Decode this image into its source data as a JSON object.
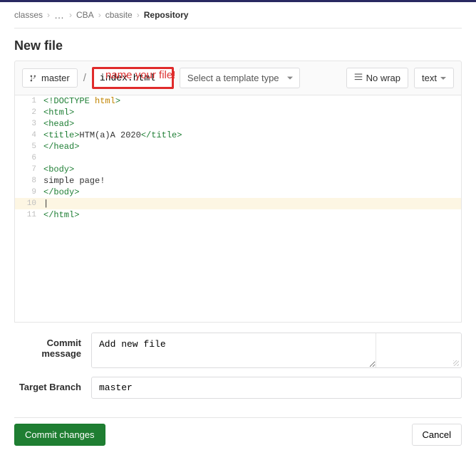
{
  "breadcrumbs": {
    "items": [
      "classes",
      "…",
      "CBA",
      "cbasite"
    ],
    "current": "Repository"
  },
  "page_title": "New file",
  "annotation": "name your file!",
  "toolbar": {
    "branch": "master",
    "filename": "index.html",
    "template_placeholder": "Select a template type",
    "nowrap": "No wrap",
    "mode": "text"
  },
  "code_lines": [
    {
      "n": 1,
      "tokens": [
        {
          "t": "<!DOCTYPE ",
          "c": "tok-doctype"
        },
        {
          "t": "html",
          "c": "tok-attr"
        },
        {
          "t": ">",
          "c": "tok-doctype"
        }
      ]
    },
    {
      "n": 2,
      "tokens": [
        {
          "t": "<",
          "c": "tok-tag"
        },
        {
          "t": "html",
          "c": "tok-tag"
        },
        {
          "t": ">",
          "c": "tok-tag"
        }
      ]
    },
    {
      "n": 3,
      "tokens": [
        {
          "t": "<",
          "c": "tok-tag"
        },
        {
          "t": "head",
          "c": "tok-tag"
        },
        {
          "t": ">",
          "c": "tok-tag"
        }
      ]
    },
    {
      "n": 4,
      "tokens": [
        {
          "t": "<",
          "c": "tok-tag"
        },
        {
          "t": "title",
          "c": "tok-tag"
        },
        {
          "t": ">",
          "c": "tok-tag"
        },
        {
          "t": "HTM(a)A 2020",
          "c": "tok-text"
        },
        {
          "t": "</",
          "c": "tok-tag"
        },
        {
          "t": "title",
          "c": "tok-tag"
        },
        {
          "t": ">",
          "c": "tok-tag"
        }
      ]
    },
    {
      "n": 5,
      "tokens": [
        {
          "t": "</",
          "c": "tok-tag"
        },
        {
          "t": "head",
          "c": "tok-tag"
        },
        {
          "t": ">",
          "c": "tok-tag"
        }
      ]
    },
    {
      "n": 6,
      "tokens": []
    },
    {
      "n": 7,
      "tokens": [
        {
          "t": "<",
          "c": "tok-tag"
        },
        {
          "t": "body",
          "c": "tok-tag"
        },
        {
          "t": ">",
          "c": "tok-tag"
        }
      ]
    },
    {
      "n": 8,
      "tokens": [
        {
          "t": "simple page!",
          "c": "tok-text"
        }
      ]
    },
    {
      "n": 9,
      "tokens": [
        {
          "t": "</",
          "c": "tok-tag"
        },
        {
          "t": "body",
          "c": "tok-tag"
        },
        {
          "t": ">",
          "c": "tok-tag"
        }
      ]
    },
    {
      "n": 10,
      "tokens": [],
      "hl": true,
      "cursor": true
    },
    {
      "n": 11,
      "tokens": [
        {
          "t": "</",
          "c": "tok-tag"
        },
        {
          "t": "html",
          "c": "tok-tag"
        },
        {
          "t": ">",
          "c": "tok-tag"
        }
      ]
    }
  ],
  "form": {
    "commit_label": "Commit message",
    "commit_value": "Add new file",
    "branch_label": "Target Branch",
    "branch_value": "master",
    "commit_btn": "Commit changes",
    "cancel_btn": "Cancel"
  },
  "accent_color": "#1f7e32"
}
